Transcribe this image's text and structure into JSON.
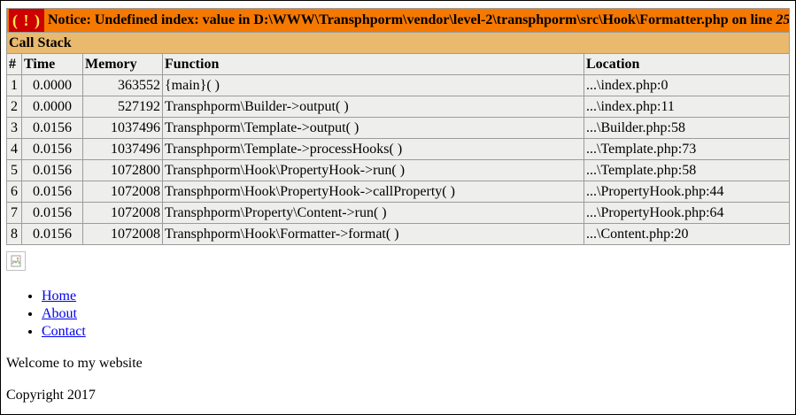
{
  "notice": {
    "icon_text": "( ! )",
    "message": "Notice: Undefined index: value in D:\\WWW\\Transphporm\\vendor\\level-2\\transphporm\\src\\Hook\\Formatter.php on line",
    "line": "25"
  },
  "call_stack": {
    "title": "Call Stack",
    "headers": [
      "#",
      "Time",
      "Memory",
      "Function",
      "Location"
    ],
    "rows": [
      {
        "num": "1",
        "time": "0.0000",
        "memory": "363552",
        "function": "{main}( )",
        "location": "...\\index.php:0"
      },
      {
        "num": "2",
        "time": "0.0000",
        "memory": "527192",
        "function": "Transphporm\\Builder->output( )",
        "location": "...\\index.php:11"
      },
      {
        "num": "3",
        "time": "0.0156",
        "memory": "1037496",
        "function": "Transphporm\\Template->output( )",
        "location": "...\\Builder.php:58"
      },
      {
        "num": "4",
        "time": "0.0156",
        "memory": "1037496",
        "function": "Transphporm\\Template->processHooks( )",
        "location": "...\\Template.php:73"
      },
      {
        "num": "5",
        "time": "0.0156",
        "memory": "1072800",
        "function": "Transphporm\\Hook\\PropertyHook->run( )",
        "location": "...\\Template.php:58"
      },
      {
        "num": "6",
        "time": "0.0156",
        "memory": "1072008",
        "function": "Transphporm\\Hook\\PropertyHook->callProperty( )",
        "location": "...\\PropertyHook.php:44"
      },
      {
        "num": "7",
        "time": "0.0156",
        "memory": "1072008",
        "function": "Transphporm\\Property\\Content->run( )",
        "location": "...\\PropertyHook.php:64"
      },
      {
        "num": "8",
        "time": "0.0156",
        "memory": "1072008",
        "function": "Transphporm\\Hook\\Formatter->format( )",
        "location": "...\\Content.php:20"
      }
    ]
  },
  "nav": {
    "items": [
      {
        "label": "Home"
      },
      {
        "label": "About"
      },
      {
        "label": "Contact"
      }
    ]
  },
  "welcome_text": "Welcome to my website",
  "copyright_text": "Copyright 2017",
  "colors": {
    "notice_bg": "#f57900",
    "notice_icon_bg": "#cc0000",
    "notice_icon_fg": "#fce94f",
    "stack_title_bg": "#e9b96e",
    "cell_bg": "#eeeeec",
    "link": "#0000ee"
  }
}
